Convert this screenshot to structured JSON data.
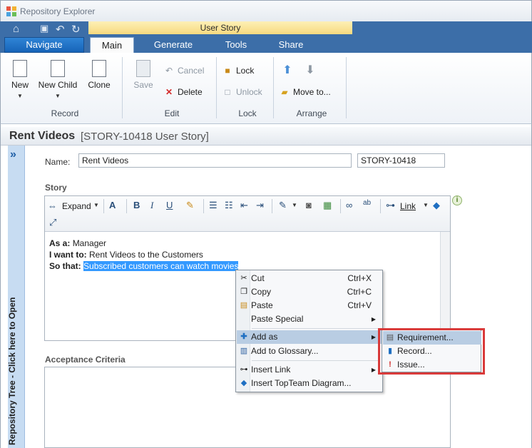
{
  "window": {
    "title": "Repository Explorer"
  },
  "quick_access": {
    "home_icon": "home-icon",
    "save_icon": "save-icon",
    "undo_icon": "undo-icon",
    "refresh_icon": "refresh-icon"
  },
  "navigate_label": "Navigate",
  "context_tab_group": "User Story",
  "tabs": [
    {
      "label": "Main",
      "active": true
    },
    {
      "label": "Generate",
      "active": false
    },
    {
      "label": "Tools",
      "active": false
    },
    {
      "label": "Share",
      "active": false
    }
  ],
  "ribbon": {
    "record": {
      "group": "Record",
      "new": "New",
      "new_child": "New Child",
      "clone": "Clone"
    },
    "edit": {
      "group": "Edit",
      "save": "Save",
      "cancel": "Cancel",
      "delete": "Delete"
    },
    "lock": {
      "group": "Lock",
      "lock": "Lock",
      "unlock": "Unlock"
    },
    "arrange": {
      "group": "Arrange",
      "move_to": "Move to..."
    }
  },
  "record_header": {
    "name": "Rent Videos",
    "subtitle": "[STORY-10418 User Story]"
  },
  "side_panel": {
    "label": "Repository Tree - Click here to Open"
  },
  "form": {
    "name_label": "Name:",
    "name_value": "Rent Videos",
    "id_value": "STORY-10418",
    "story_label": "Story",
    "acceptance_label": "Acceptance Criteria"
  },
  "editor_toolbar": {
    "expand": "Expand",
    "link": "Link"
  },
  "story": {
    "as_a_label": "As a:",
    "as_a_value": "Manager",
    "want_label": "I want to:",
    "want_value": "Rent Videos to the Customers",
    "so_that_label": "So that:",
    "so_that_value": "Subscribed customers can watch movies"
  },
  "context_menu": {
    "cut": "Cut",
    "cut_key": "Ctrl+X",
    "copy": "Copy",
    "copy_key": "Ctrl+C",
    "paste": "Paste",
    "paste_key": "Ctrl+V",
    "paste_special": "Paste Special",
    "add_as": "Add as",
    "add_to_glossary": "Add to Glossary...",
    "insert_link": "Insert Link",
    "insert_diagram": "Insert TopTeam Diagram..."
  },
  "submenu": {
    "requirement": "Requirement...",
    "record": "Record...",
    "issue": "Issue..."
  },
  "colors": {
    "ribbon_blue": "#3c6ea8",
    "context_yellow": "#f7d97f",
    "selection": "#3399ff",
    "highlight_box": "#d93a3a"
  }
}
